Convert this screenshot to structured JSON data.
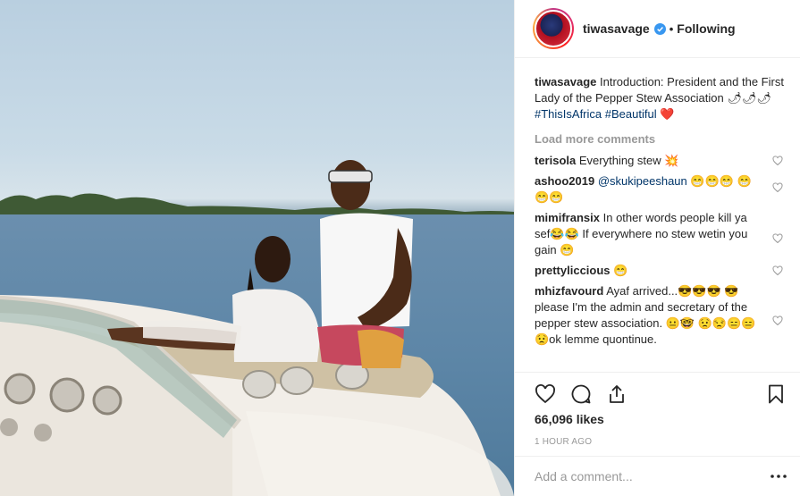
{
  "post": {
    "owner": "tiwasavage",
    "follow_state": "Following",
    "separator": "•",
    "caption_text": "Introduction: President and the First Lady of the Pepper Stew Association 🌶🌶🌶",
    "caption_tags": [
      "#ThisIsAfrica",
      "#Beautiful"
    ],
    "caption_emoji": "❤️",
    "load_more": "Load more comments",
    "likes": "66,096 likes",
    "time": "1 HOUR AGO",
    "add_comment_placeholder": "Add a comment..."
  },
  "comments": [
    {
      "user": "terisola",
      "text": "Everything stew 💥"
    },
    {
      "user": "ashoo2019",
      "mention": "@skukipeeshaun",
      "text": "😁😁😁 😁😁😁"
    },
    {
      "user": "mimifransix",
      "text": "In other words people kill ya sef😂😂 If everywhere no stew wetin you gain 😁"
    },
    {
      "user": "prettyliccious",
      "text": "😁"
    },
    {
      "user": "mhizfavourd",
      "text": "Ayaf arrived...😎😎😎 😎please I'm the admin and secretary of the pepper stew association. 😐🤓 😟😒😑😑😟ok lemme quontinue."
    }
  ],
  "icons": {
    "verified": "verified-badge-icon",
    "like": "heart-icon",
    "comment": "comment-icon",
    "share": "share-icon",
    "save": "bookmark-icon",
    "more": "more-options-icon"
  },
  "colors": {
    "link": "#003569",
    "verified": "#3897f0",
    "muted": "#999999",
    "heart": "#ed4956"
  }
}
